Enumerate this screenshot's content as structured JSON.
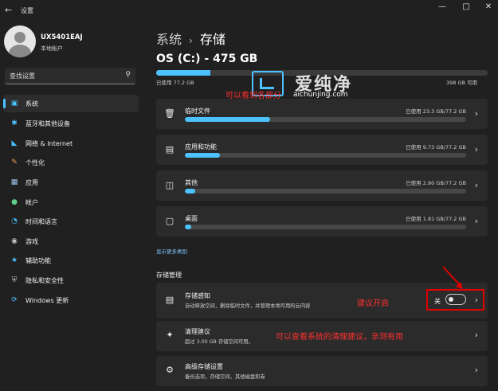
{
  "window": {
    "app_title": "设置",
    "controls": {
      "minimize": "—",
      "maximize": "□",
      "close": "✕"
    }
  },
  "user": {
    "name": "UX5401EAJ",
    "account_type": "本地帐户"
  },
  "search": {
    "placeholder": "查找设置"
  },
  "sidebar": {
    "items": [
      {
        "label": "系统",
        "icon": "monitor-icon",
        "color": "#4cc2ff",
        "active": true
      },
      {
        "label": "蓝牙和其他设备",
        "icon": "bluetooth-icon",
        "color": "#4cc2ff"
      },
      {
        "label": "网络 & Internet",
        "icon": "wifi-icon",
        "color": "#4cc2ff"
      },
      {
        "label": "个性化",
        "icon": "brush-icon",
        "color": "#f0a050"
      },
      {
        "label": "应用",
        "icon": "apps-icon",
        "color": "#9ec8f0"
      },
      {
        "label": "帐户",
        "icon": "person-icon",
        "color": "#5fd08a"
      },
      {
        "label": "时间和语言",
        "icon": "globe-clock-icon",
        "color": "#4cc2ff"
      },
      {
        "label": "游戏",
        "icon": "gamepad-icon",
        "color": "#c8c8c8"
      },
      {
        "label": "辅助功能",
        "icon": "accessibility-icon",
        "color": "#4cc2ff"
      },
      {
        "label": "隐私和安全性",
        "icon": "shield-icon",
        "color": "#c8c8c8"
      },
      {
        "label": "Windows 更新",
        "icon": "update-icon",
        "color": "#4cc2ff"
      }
    ]
  },
  "main": {
    "breadcrumb_parent": "系统",
    "breadcrumb_current": "存储",
    "drive_title": "OS (C:) - 475 GB",
    "used_label": "已使用 77.2 GB",
    "total_label": "398 GB 可用",
    "used_fraction": 0.163,
    "categories": [
      {
        "name": "临时文件",
        "icon": "trash-icon",
        "usage": "已使用 23.3 GB/77.2 GB",
        "fraction": 0.302
      },
      {
        "name": "应用和功能",
        "icon": "apps-list-icon",
        "usage": "已使用 9.73 GB/77.2 GB",
        "fraction": 0.126
      },
      {
        "name": "其他",
        "icon": "file-icon",
        "usage": "已使用 2.80 GB/77.2 GB",
        "fraction": 0.036
      },
      {
        "name": "桌面",
        "icon": "desktop-icon",
        "usage": "已使用 1.81 GB/77.2 GB",
        "fraction": 0.023
      }
    ],
    "show_more": "显示更多类别",
    "management_title": "存储管理",
    "storage_sense": {
      "title": "存储感知",
      "desc": "自动释放空间，删除临时文件，并管理本地可用的云内容",
      "toggle_label": "关",
      "toggle_on": false
    },
    "cleanup": {
      "title": "清理建议",
      "desc": "超过 3.00 GB 存储空间可用。"
    },
    "advanced": {
      "title": "高级存储设置",
      "desc": "备份选项，存储空间，其他磁盘和卷"
    }
  },
  "annotations": {
    "top_note": "可以看到各部分",
    "enable_note": "建议开启",
    "cleanup_note": "可以查看系统的清理建议，亲测有用",
    "color": "#ff3030"
  },
  "watermark": {
    "name": "爱纯净",
    "url": "aichunjing.com"
  }
}
